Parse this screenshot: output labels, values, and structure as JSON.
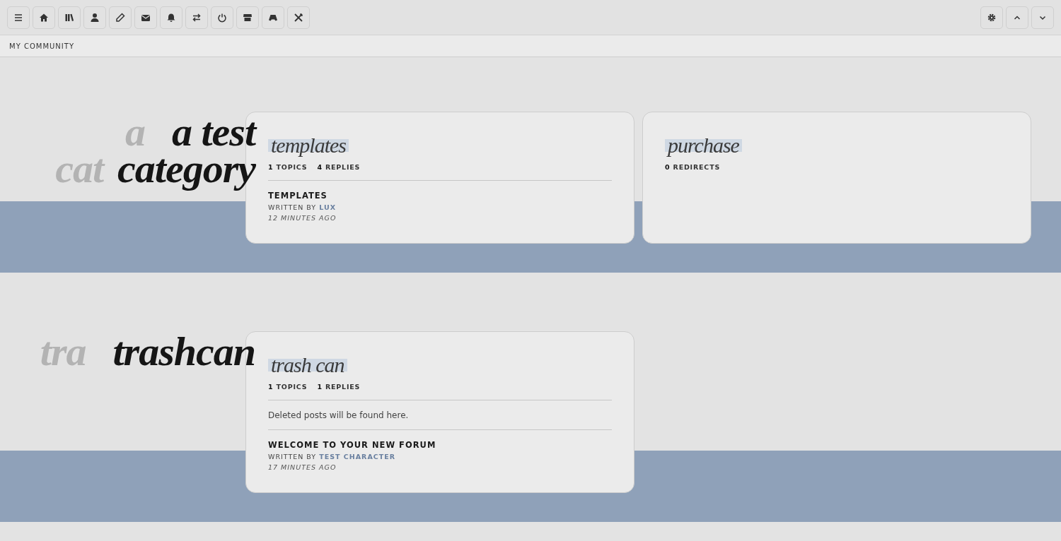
{
  "breadcrumb": "MY COMMUNITY",
  "categories": [
    {
      "title_lines": [
        {
          "backdrop": "a",
          "text": "a test"
        },
        {
          "backdrop": "cat",
          "text": "category"
        }
      ],
      "forums": [
        {
          "name": "templates",
          "stats": [
            {
              "count": "1",
              "label": "TOPICS"
            },
            {
              "count": "4",
              "label": "REPLIES"
            }
          ],
          "last_post": {
            "title": "TEMPLATES",
            "by_label": "WRITTEN BY",
            "author": "LUX",
            "time": "12 MINUTES AGO"
          }
        },
        {
          "name": "purchase",
          "stats": [
            {
              "count": "0",
              "label": "REDIRECTS"
            }
          ]
        }
      ]
    },
    {
      "title_lines": [
        {
          "backdrop": "tra",
          "text": "trashcan"
        }
      ],
      "forums": [
        {
          "name": "trash can",
          "stats": [
            {
              "count": "1",
              "label": "TOPICS"
            },
            {
              "count": "1",
              "label": "REPLIES"
            }
          ],
          "description": "Deleted posts will be found here.",
          "last_post": {
            "title": "WELCOME TO YOUR NEW FORUM",
            "by_label": "WRITTEN BY",
            "author": "TEST CHARACTER",
            "time": "17 MINUTES AGO"
          }
        }
      ]
    }
  ]
}
